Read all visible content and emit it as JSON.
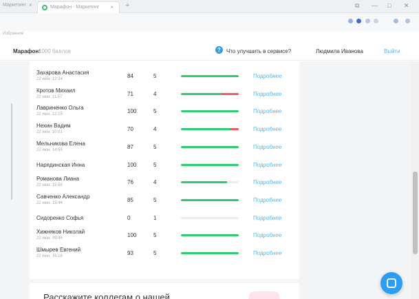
{
  "browser": {
    "prev_tab": "Маркетинг",
    "active_tab_title": "Марафон - Маркетинг",
    "close_glyph": "×",
    "new_tab_glyph": "+",
    "window_buttons": [
      "⧉",
      "—",
      "□",
      "✕"
    ],
    "bookmark_text": "Избранное"
  },
  "header": {
    "marathon_label": "Марафон:",
    "marathon_sub": "1000 баллов",
    "help_icon_glyph": "?",
    "help_link": "Что улучшить в сервисе?",
    "user_name": "Людмила Иванова",
    "logout": "Выйти"
  },
  "rows": [
    {
      "name": "Захарова Анастасия",
      "date": "22 июн. 12:24",
      "score": "84",
      "days": "5",
      "progress": 1.0,
      "red": 0.0
    },
    {
      "name": "Кротов Михаил",
      "date": "22 июн. 11:57",
      "score": "71",
      "days": "4",
      "progress": 0.7,
      "red": 0.3
    },
    {
      "name": "Лавриненко Ольга",
      "date": "22 июн. 12:15",
      "score": "100",
      "days": "5",
      "progress": 1.0,
      "red": 0.0
    },
    {
      "name": "Нехин Вадим",
      "date": "22 июн. 10:01",
      "score": "70",
      "days": "4",
      "progress": 0.86,
      "red": 0.14
    },
    {
      "name": "Мельникова Елена",
      "date": "22 июн. 14:55",
      "score": "87",
      "days": "5",
      "progress": 1.0,
      "red": 0.0
    },
    {
      "name": "Нарядинская Инна",
      "date": "",
      "score": "100",
      "days": "5",
      "progress": 1.0,
      "red": 0.0
    },
    {
      "name": "Романова Лиана",
      "date": "22 июн. 15:58",
      "score": "76",
      "days": "4",
      "progress": 0.8,
      "red": 0.0
    },
    {
      "name": "Савченко Александр",
      "date": "22 июн. 15:44",
      "score": "85",
      "days": "5",
      "progress": 1.0,
      "red": 0.0
    },
    {
      "name": "Сидоренко Софья",
      "date": "",
      "score": "0",
      "days": "1",
      "progress": 0.0,
      "red": 0.0
    },
    {
      "name": "Хижняков Николай",
      "date": "22 июн. 09:46",
      "score": "100",
      "days": "5",
      "progress": 1.0,
      "red": 0.0
    },
    {
      "name": "Шмырев Евгений",
      "date": "22 июн. 16:18",
      "score": "93",
      "days": "5",
      "progress": 1.0,
      "red": 0.0
    }
  ],
  "details_label": "Подробнее",
  "promo": {
    "title": "Расскажите коллегам о нашей"
  },
  "colors": {
    "green": "#2ecc71",
    "red": "#f05a5a",
    "link": "#56b7ef",
    "accent": "#2a9df4"
  }
}
